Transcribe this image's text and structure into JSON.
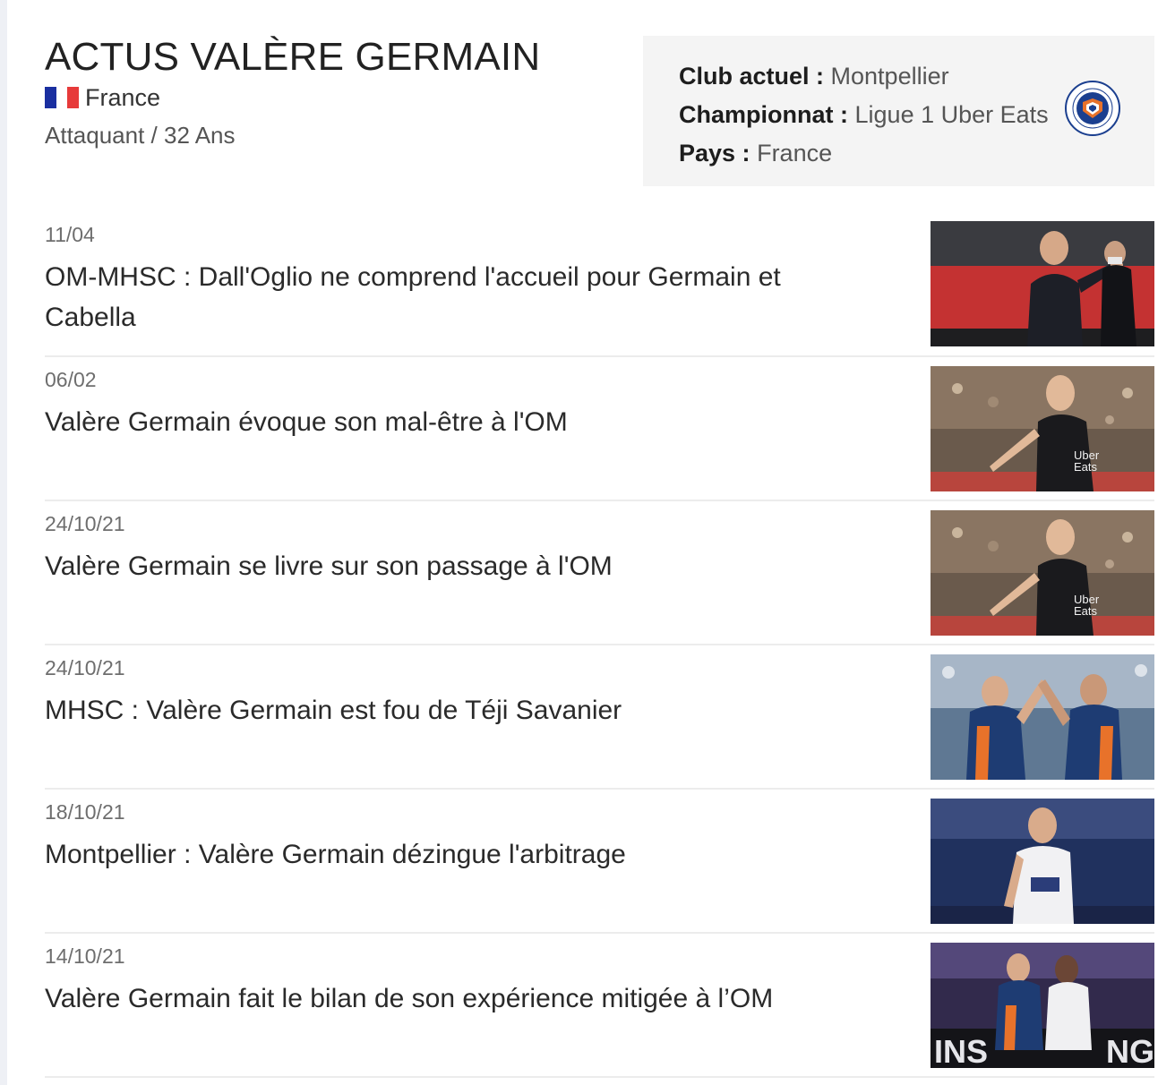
{
  "player": {
    "title": "ACTUS VALÈRE GERMAIN",
    "country": "France",
    "position_age": "Attaquant / 32 Ans"
  },
  "info": {
    "club_label": "Club actuel :",
    "club_value": "Montpellier",
    "league_label": "Championnat :",
    "league_value": "Ligue 1 Uber Eats",
    "country_label": "Pays :",
    "country_value": "France",
    "logo_icon": "montpellier-club-logo-icon"
  },
  "news": [
    {
      "date": "11/04",
      "title": "OM-MHSC : Dall'Oglio ne comprend l'accueil pour Germain et Cabella"
    },
    {
      "date": "06/02",
      "title": "Valère Germain évoque son mal-être à l'OM"
    },
    {
      "date": "24/10/21",
      "title": "Valère Germain se livre sur son passage à l'OM"
    },
    {
      "date": "24/10/21",
      "title": "MHSC : Valère Germain est fou de Téji Savanier"
    },
    {
      "date": "18/10/21",
      "title": "Montpellier : Valère Germain dézingue l'arbitrage"
    },
    {
      "date": "14/10/21",
      "title": "Valère Germain fait le bilan de son expérience mitigée à l’OM"
    }
  ],
  "colors": {
    "flag_blue": "#1a2fa0",
    "flag_red": "#e73a3a",
    "montpellier_orange": "#e8722a",
    "montpellier_blue": "#1b3f8f"
  }
}
